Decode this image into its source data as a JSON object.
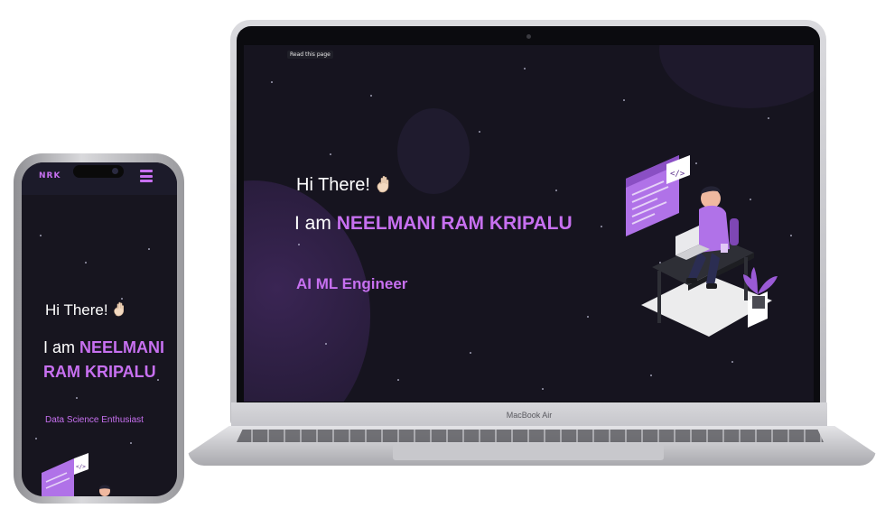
{
  "laptop": {
    "device_label": "MacBook Air",
    "read_badge": "Read this page",
    "greeting": "Hi There!",
    "intro_prefix": "I am",
    "name": "NEELMANI RAM KRIPALU",
    "role": "AI ML Engineer"
  },
  "phone": {
    "logo": "NRK",
    "greeting": "Hi There!",
    "intro_prefix": "I am",
    "name_line1": "NEELMANI",
    "name_line2": "RAM KRIPALU",
    "role": "Data Science Enthusiast"
  },
  "icons": {
    "wave": "waving-hand-icon",
    "menu": "hamburger-menu-icon",
    "camera": "front-camera-icon",
    "illustration": "developer-at-desk-illustration"
  },
  "colors": {
    "background": "#16141f",
    "accent": "#c770f0",
    "text": "#ffffff",
    "nav": "#1c1b2a"
  }
}
